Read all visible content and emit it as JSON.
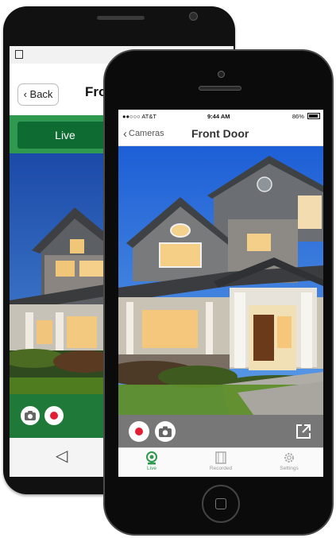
{
  "android": {
    "back_label": "Back",
    "title_partial": "Fro",
    "live_tab_label": "Live"
  },
  "iphone": {
    "status": {
      "carrier": "●●○○○ AT&T",
      "time": "9:44 AM",
      "battery": "86%"
    },
    "nav": {
      "back_label": "Cameras",
      "title": "Front Door"
    },
    "tabs": [
      {
        "label": "Live",
        "icon": "camera-icon",
        "active": true
      },
      {
        "label": "Recorded",
        "icon": "film-icon",
        "active": false
      },
      {
        "label": "Settings",
        "icon": "gear-icon",
        "active": false
      }
    ]
  },
  "colors": {
    "brand_green": "#2f9a4f",
    "dark_green": "#0e6b31",
    "record_red": "#e21e35"
  }
}
